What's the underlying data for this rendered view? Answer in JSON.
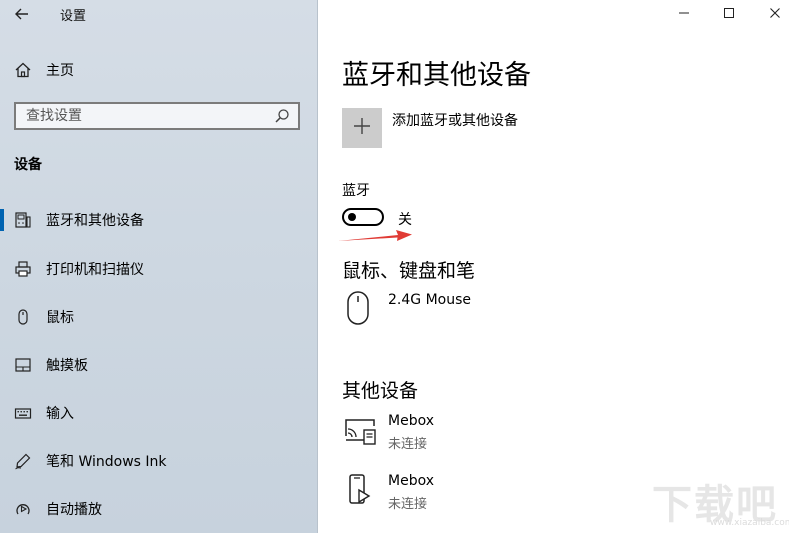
{
  "app_title": "设置",
  "sidebar": {
    "home_label": "主页",
    "search": {
      "placeholder": "查找设置"
    },
    "section_label": "设备",
    "items": [
      {
        "label": "蓝牙和其他设备",
        "icon": "bluetooth-devices-icon",
        "selected": true
      },
      {
        "label": "打印机和扫描仪",
        "icon": "printer-icon",
        "selected": false
      },
      {
        "label": "鼠标",
        "icon": "mouse-icon",
        "selected": false
      },
      {
        "label": "触摸板",
        "icon": "touchpad-icon",
        "selected": false
      },
      {
        "label": "输入",
        "icon": "keyboard-icon",
        "selected": false
      },
      {
        "label": "笔和 Windows Ink",
        "icon": "pen-icon",
        "selected": false
      },
      {
        "label": "自动播放",
        "icon": "autoplay-icon",
        "selected": false
      }
    ]
  },
  "main": {
    "title": "蓝牙和其他设备",
    "add_device_label": "添加蓝牙或其他设备",
    "bluetooth": {
      "label": "蓝牙",
      "state": "关",
      "on": false
    },
    "mouse_section": {
      "title": "鼠标、键盘和笔",
      "devices": [
        {
          "name": "2.4G Mouse",
          "status": "",
          "icon": "mouse-icon"
        }
      ]
    },
    "other_section": {
      "title": "其他设备",
      "devices": [
        {
          "name": "Mebox",
          "status": "未连接",
          "icon": "cast-display-icon"
        },
        {
          "name": "Mebox",
          "status": "未连接",
          "icon": "media-device-icon"
        }
      ]
    }
  },
  "watermark": {
    "text": "下载吧",
    "url": "www.xiazaiba.com"
  },
  "colors": {
    "accent": "#0063b1",
    "arrow": "#e03b35"
  }
}
